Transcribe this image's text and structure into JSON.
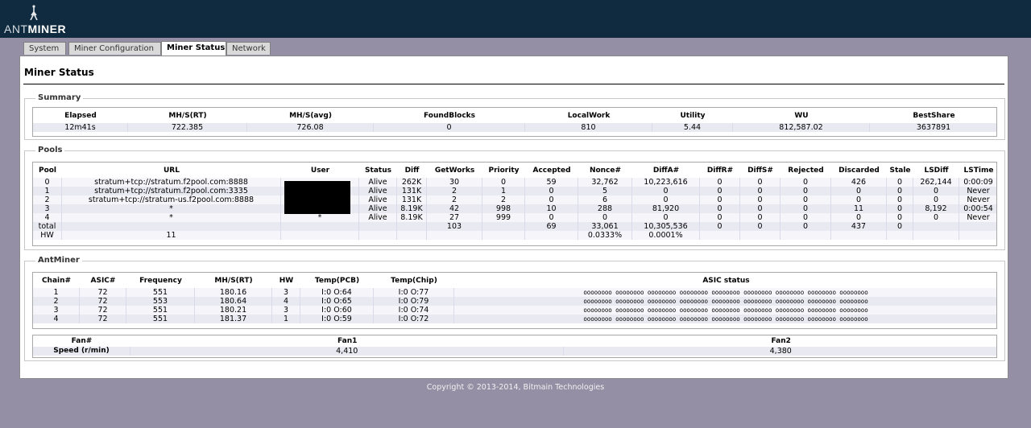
{
  "brand": {
    "prefix": "ANT",
    "suffix": "MINER"
  },
  "tabs": [
    {
      "label": "System"
    },
    {
      "label": "Miner Configuration"
    },
    {
      "label": "Miner Status"
    },
    {
      "label": "Network"
    }
  ],
  "page_title": "Miner Status",
  "summary": {
    "legend": "Summary",
    "headers": [
      "Elapsed",
      "MH/S(RT)",
      "MH/S(avg)",
      "FoundBlocks",
      "LocalWork",
      "Utility",
      "WU",
      "BestShare"
    ],
    "values": [
      "12m41s",
      "722.385",
      "726.08",
      "0",
      "810",
      "5.44",
      "812,587.02",
      "3637891"
    ]
  },
  "pools": {
    "legend": "Pools",
    "headers": [
      "Pool",
      "URL",
      "User",
      "Status",
      "Diff",
      "GetWorks",
      "Priority",
      "Accepted",
      "Nonce#",
      "DiffA#",
      "DiffR#",
      "DiffS#",
      "Rejected",
      "Discarded",
      "Stale",
      "LSDiff",
      "LSTime"
    ],
    "rows": [
      [
        "0",
        "stratum+tcp://stratum.f2pool.com:8888",
        "",
        "Alive",
        "262K",
        "30",
        "0",
        "59",
        "32,762",
        "10,223,616",
        "0",
        "0",
        "0",
        "426",
        "0",
        "262,144",
        "0:00:09"
      ],
      [
        "1",
        "stratum+tcp://stratum.f2pool.com:3335",
        "",
        "Alive",
        "131K",
        "2",
        "1",
        "0",
        "5",
        "0",
        "0",
        "0",
        "0",
        "0",
        "0",
        "0",
        "Never"
      ],
      [
        "2",
        "stratum+tcp://stratum-us.f2pool.com:8888",
        "",
        "Alive",
        "131K",
        "2",
        "2",
        "0",
        "6",
        "0",
        "0",
        "0",
        "0",
        "0",
        "0",
        "0",
        "Never"
      ],
      [
        "3",
        "*",
        "",
        "Alive",
        "8.19K",
        "42",
        "998",
        "10",
        "288",
        "81,920",
        "0",
        "0",
        "0",
        "11",
        "0",
        "8,192",
        "0:00:54"
      ],
      [
        "4",
        "*",
        "*",
        "Alive",
        "8.19K",
        "27",
        "999",
        "0",
        "0",
        "0",
        "0",
        "0",
        "0",
        "0",
        "0",
        "0",
        "Never"
      ],
      [
        "total",
        "",
        "",
        "",
        "",
        "103",
        "",
        "69",
        "33,061",
        "10,305,536",
        "0",
        "0",
        "0",
        "437",
        "0",
        "",
        ""
      ],
      [
        "HW",
        "11",
        "",
        "",
        "",
        "",
        "",
        "",
        "0.0333%",
        "0.0001%",
        "",
        "",
        "",
        "",
        "",
        "",
        ""
      ]
    ]
  },
  "antminer": {
    "legend": "AntMiner",
    "headers": [
      "Chain#",
      "ASIC#",
      "Frequency",
      "MH/S(RT)",
      "HW",
      "Temp(PCB)",
      "Temp(Chip)",
      "ASIC status"
    ],
    "rows": [
      [
        "1",
        "72",
        "551",
        "180.16",
        "3",
        "I:0 O:64",
        "I:0 O:77",
        "oooooooo oooooooo oooooooo oooooooo oooooooo oooooooo oooooooo oooooooo oooooooo"
      ],
      [
        "2",
        "72",
        "553",
        "180.64",
        "4",
        "I:0 O:65",
        "I:0 O:79",
        "oooooooo oooooooo oooooooo oooooooo oooooooo oooooooo oooooooo oooooooo oooooooo"
      ],
      [
        "3",
        "72",
        "551",
        "180.21",
        "3",
        "I:0 O:60",
        "I:0 O:74",
        "oooooooo oooooooo oooooooo oooooooo oooooooo oooooooo oooooooo oooooooo oooooooo"
      ],
      [
        "4",
        "72",
        "551",
        "181.37",
        "1",
        "I:0 O:59",
        "I:0 O:72",
        "oooooooo oooooooo oooooooo oooooooo oooooooo oooooooo oooooooo oooooooo oooooooo"
      ]
    ],
    "fan": {
      "header_label": "Fan#",
      "row_label": "Speed (r/min)",
      "fans": [
        {
          "name": "Fan1",
          "speed": "4,410"
        },
        {
          "name": "Fan2",
          "speed": "4,380"
        }
      ]
    }
  },
  "footer": "Copyright © 2013-2014, Bitmain Technologies"
}
